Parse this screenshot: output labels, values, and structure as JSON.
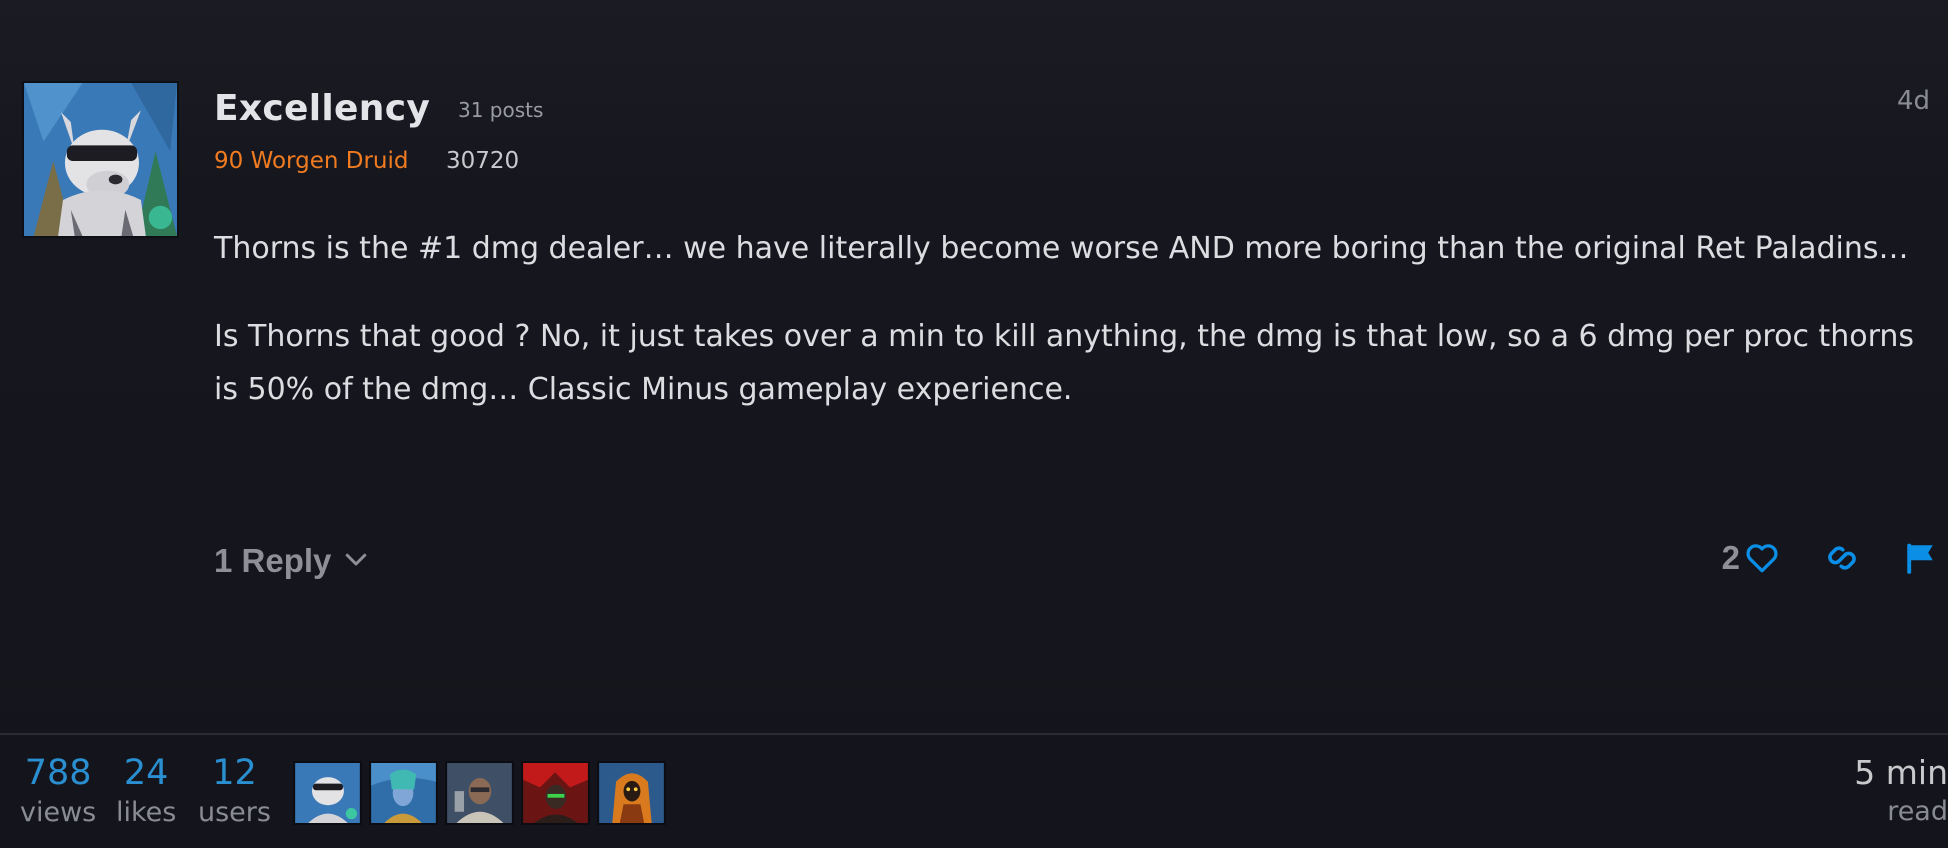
{
  "post": {
    "username": "Excellency",
    "post_count": "31 posts",
    "character": "90 Worgen Druid",
    "achievement_points": "30720",
    "age": "4d",
    "paragraphs": [
      "Thorns is the #1 dmg dealer… we have literally become worse AND more boring than the original Ret Paladins…",
      "Is Thorns that good ? No, it just takes over a min to kill anything, the dmg is that low, so a 6 dmg per proc thorns is 50% of the dmg… Classic Minus gameplay experience."
    ],
    "replies_label": "1 Reply",
    "like_count": "2"
  },
  "icons": {
    "replies_toggle": "chevron-down-icon",
    "like": "heart-icon",
    "link": "link-icon",
    "flag": "flag-icon"
  },
  "colors": {
    "background": "#15161d",
    "username": "#e3e4e7",
    "class_druid": "#f07b21",
    "accent_blue": "#0b8ee6",
    "stat_number": "#2a8fd0",
    "muted": "#8e9096"
  },
  "topic_map": {
    "views": {
      "number": "788",
      "label": "views"
    },
    "likes": {
      "number": "24",
      "label": "likes"
    },
    "users": {
      "number": "12",
      "label": "users"
    },
    "read_time": {
      "number": "5 min",
      "label": "read"
    },
    "participant_count": 5
  }
}
